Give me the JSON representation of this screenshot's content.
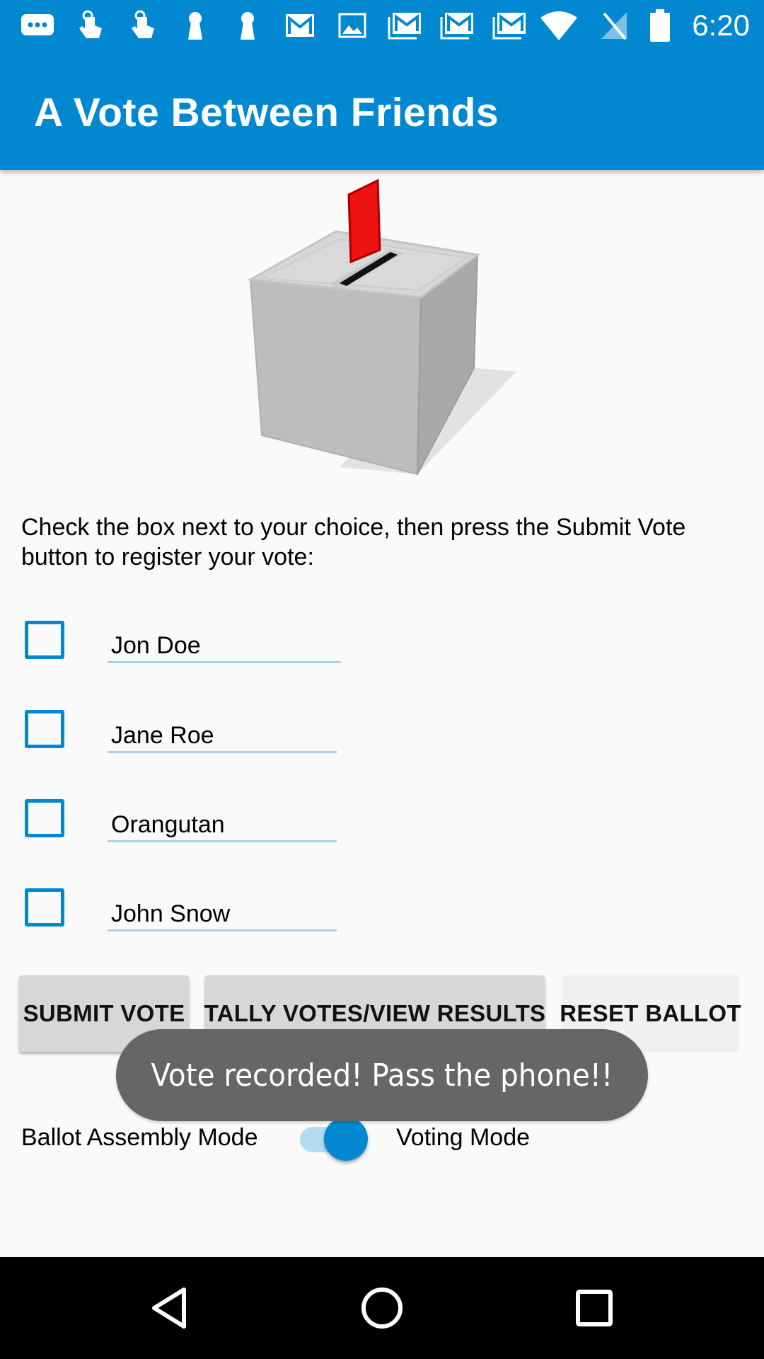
{
  "status_bar": {
    "time": "6:20",
    "icons": [
      "message-icon",
      "touch-icon",
      "touch-icon",
      "keyhole-icon",
      "keyhole-icon",
      "gmail-icon",
      "image-icon",
      "gmail-stack-icon",
      "gmail-stack-icon",
      "gmail-stack-icon",
      "wifi-icon",
      "no-signal-icon",
      "battery-icon"
    ]
  },
  "app_bar": {
    "title": "A Vote Between Friends"
  },
  "instructions": "Check the box next to your choice, then press the Submit Vote button to register your vote:",
  "choices": [
    {
      "label": "Jon Doe",
      "checked": false
    },
    {
      "label": "Jane Roe",
      "checked": false
    },
    {
      "label": "Orangutan",
      "checked": false
    },
    {
      "label": "John Snow",
      "checked": false
    }
  ],
  "buttons": {
    "submit": "SUBMIT VOTE",
    "tally": "TALLY VOTES/VIEW RESULTS",
    "reset": "RESET BALLOT"
  },
  "mode": {
    "left_label": "Ballot Assembly Mode",
    "right_label": "Voting Mode",
    "voting_mode_on": true
  },
  "toast": "Vote recorded! Pass the phone!!",
  "colors": {
    "primary": "#0288d1",
    "toast_bg": "#666666",
    "ballot_red": "#ee1111"
  }
}
